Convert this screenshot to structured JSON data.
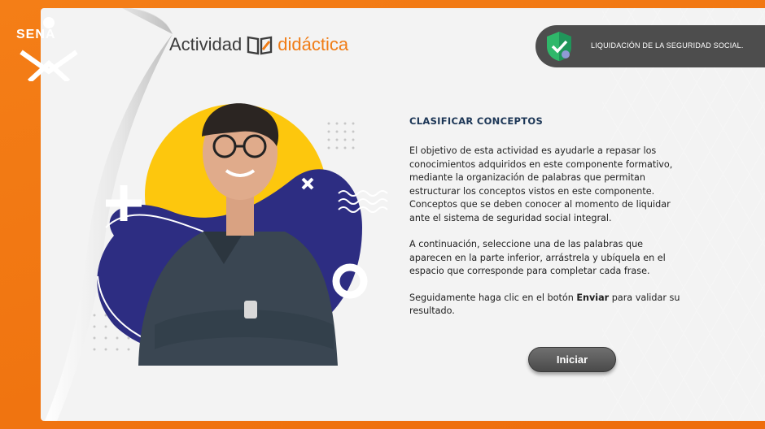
{
  "brand": {
    "logo_text": "SENA",
    "title_part1": "Actividad",
    "title_part2": "didáctica",
    "icon": "open-book-pencil-icon",
    "accent_color": "#f07c15"
  },
  "header": {
    "icon": "shield-check-icon",
    "topic": "LIQUIDACIÓN DE LA SEGURIDAD SOCIAL."
  },
  "main": {
    "heading": "CLASIFICAR CONCEPTOS",
    "paragraph1": "El objetivo de esta actividad es ayudarle a repasar los conocimientos adquiridos en este componente formativo, mediante la organización de palabras que permitan estructurar los conceptos vistos en este componente. Conceptos que se deben conocer al momento de liquidar ante el sistema de seguridad social integral.",
    "paragraph2": "A continuación, seleccione una de las palabras que aparecen en la parte inferior, arrástrela y ubíquela en el espacio que corresponde para completar cada frase.",
    "paragraph3_prefix": "Seguidamente haga clic en el botón ",
    "paragraph3_bold": "Enviar",
    "paragraph3_suffix": " para validar su resultado.",
    "start_button": "Iniciar"
  }
}
